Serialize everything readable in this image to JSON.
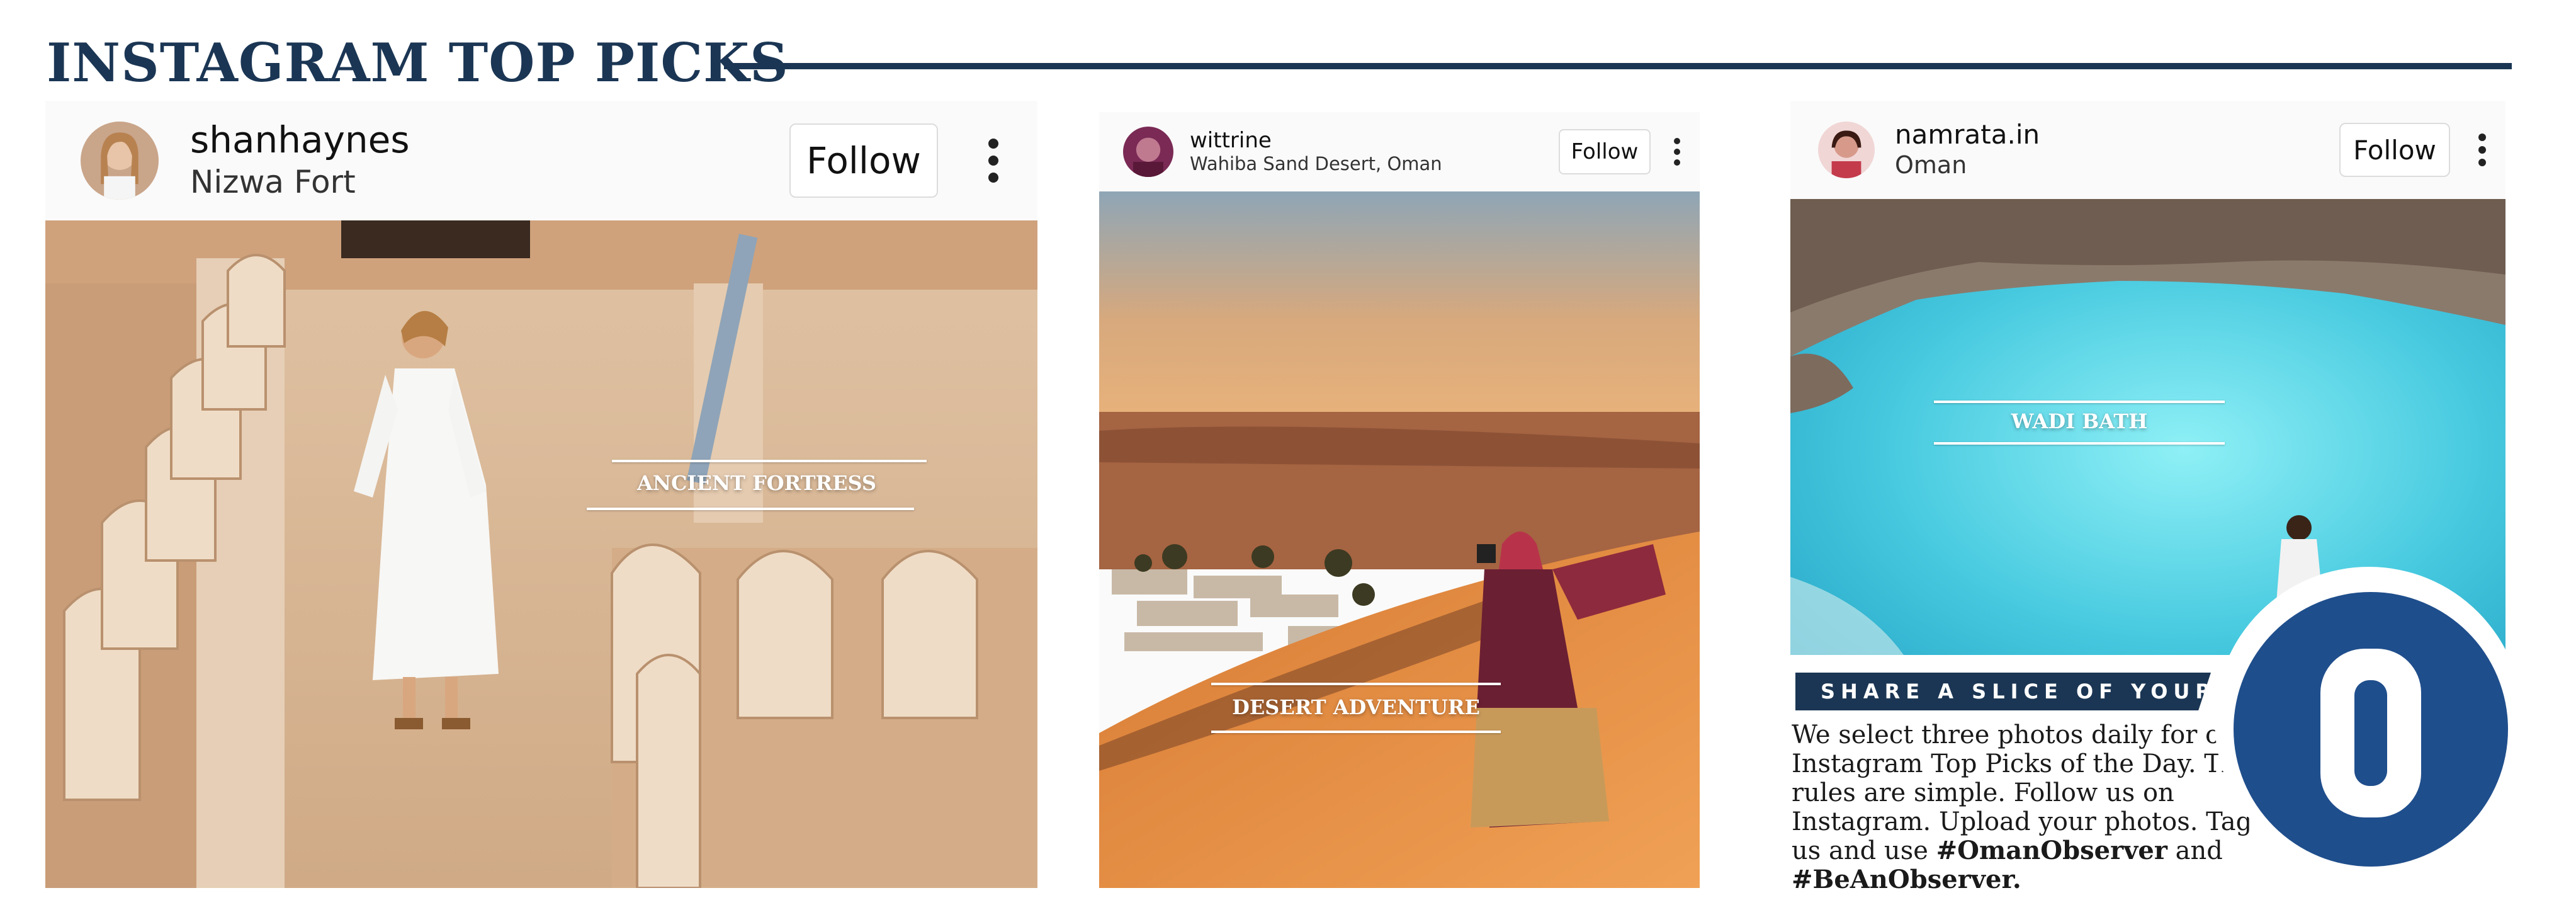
{
  "header": {
    "title": "INSTAGRAM TOP PICKS"
  },
  "posts": [
    {
      "username": "shanhaynes",
      "location": "Nizwa Fort",
      "follow_label": "Follow",
      "caption": "ANCIENT FORTRESS"
    },
    {
      "username": "wittrine",
      "location": "Wahiba Sand Desert, Oman",
      "follow_label": "Follow",
      "caption": "DESERT ADVENTURE"
    },
    {
      "username": "namrata.in",
      "location": "Oman",
      "follow_label": "Follow",
      "caption": "WADI BATH"
    }
  ],
  "info": {
    "banner": "SHARE A SLICE OF YOUR LIFE",
    "body": "We select three photos daily for our Instagram Top Picks of the Day. The rules are simple. Follow us on Instagram. Upload your photos. Tag us and use",
    "hashtag1": "#OmanObserver",
    "and": "and",
    "hashtag2": "#BeAnObserver."
  },
  "colors": {
    "brand_navy": "#1b3654",
    "logo_blue": "#1f4e8c",
    "water": "#5fd6e6",
    "sand": "#e59a4a"
  }
}
